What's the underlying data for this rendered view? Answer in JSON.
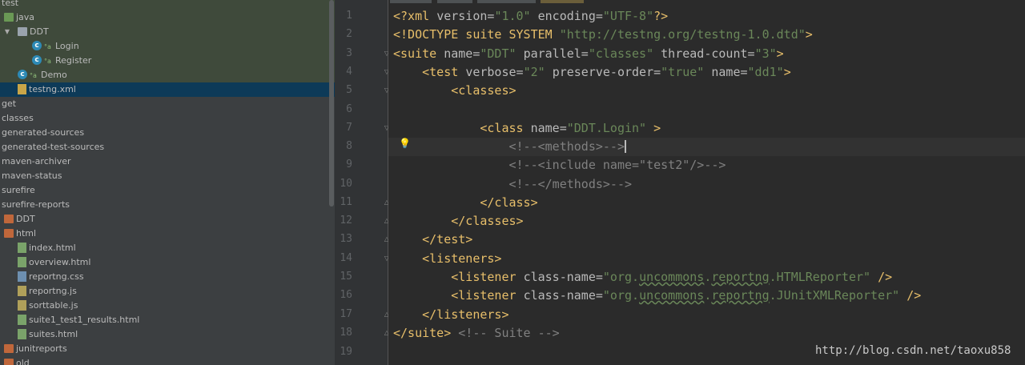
{
  "tree": {
    "items": [
      {
        "label": "test",
        "indent": 0,
        "icon": "none"
      },
      {
        "label": "java",
        "indent": 1,
        "icon": "folder-green-icon"
      },
      {
        "label": "DDT",
        "indent": 2,
        "icon": "package-icon",
        "expanded": true
      },
      {
        "label": "Login",
        "indent": 3,
        "icon": "class-icon"
      },
      {
        "label": "Register",
        "indent": 3,
        "icon": "class-icon"
      },
      {
        "label": "Demo",
        "indent": 2,
        "icon": "class-icon"
      },
      {
        "label": "testng.xml",
        "indent": 2,
        "icon": "xml-file-icon",
        "selected": true
      },
      {
        "label": "get",
        "indent": 0,
        "icon": "none"
      },
      {
        "label": "classes",
        "indent": 0,
        "icon": "none"
      },
      {
        "label": "generated-sources",
        "indent": 0,
        "icon": "none"
      },
      {
        "label": "generated-test-sources",
        "indent": 0,
        "icon": "none"
      },
      {
        "label": "maven-archiver",
        "indent": 0,
        "icon": "none"
      },
      {
        "label": "maven-status",
        "indent": 0,
        "icon": "none"
      },
      {
        "label": "surefire",
        "indent": 0,
        "icon": "none"
      },
      {
        "label": "surefire-reports",
        "indent": 0,
        "icon": "none"
      },
      {
        "label": "DDT",
        "indent": 1,
        "icon": "folder-orange-icon"
      },
      {
        "label": "html",
        "indent": 1,
        "icon": "folder-orange-icon"
      },
      {
        "label": "index.html",
        "indent": 2,
        "icon": "html-file-icon"
      },
      {
        "label": "overview.html",
        "indent": 2,
        "icon": "html-file-icon"
      },
      {
        "label": "reportng.css",
        "indent": 2,
        "icon": "css-file-icon"
      },
      {
        "label": "reportng.js",
        "indent": 2,
        "icon": "js-file-icon"
      },
      {
        "label": "sorttable.js",
        "indent": 2,
        "icon": "js-file-icon"
      },
      {
        "label": "suite1_test1_results.html",
        "indent": 2,
        "icon": "html-file-icon"
      },
      {
        "label": "suites.html",
        "indent": 2,
        "icon": "html-file-icon"
      },
      {
        "label": "junitreports",
        "indent": 1,
        "icon": "folder-orange-icon"
      },
      {
        "label": "old",
        "indent": 1,
        "icon": "folder-orange-icon"
      }
    ]
  },
  "editor": {
    "line_numbers": [
      "1",
      "2",
      "3",
      "4",
      "5",
      "6",
      "7",
      "8",
      "9",
      "10",
      "11",
      "12",
      "13",
      "14",
      "15",
      "16",
      "17",
      "18",
      "19"
    ],
    "current_line": 8
  },
  "watermark": "http://blog.csdn.net/taoxu858",
  "colors": {
    "tag": "#e8bf6a",
    "string": "#6a8759",
    "comment": "#808080",
    "selection": "#0d3a58"
  }
}
